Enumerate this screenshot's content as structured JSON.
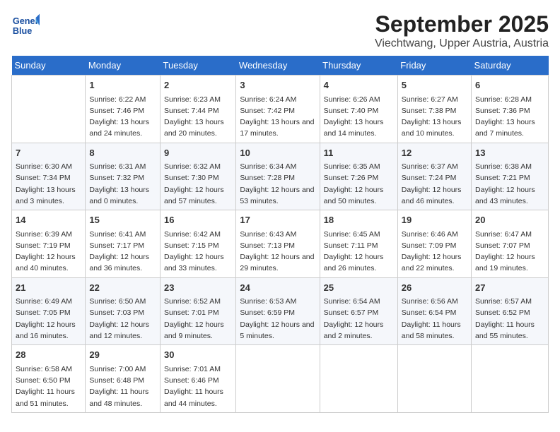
{
  "header": {
    "title": "September 2025",
    "subtitle": "Viechtwang, Upper Austria, Austria",
    "logo_line1": "General",
    "logo_line2": "Blue"
  },
  "weekdays": [
    "Sunday",
    "Monday",
    "Tuesday",
    "Wednesday",
    "Thursday",
    "Friday",
    "Saturday"
  ],
  "weeks": [
    [
      {
        "day": "",
        "sunrise": "",
        "sunset": "",
        "daylight": ""
      },
      {
        "day": "1",
        "sunrise": "Sunrise: 6:22 AM",
        "sunset": "Sunset: 7:46 PM",
        "daylight": "Daylight: 13 hours and 24 minutes."
      },
      {
        "day": "2",
        "sunrise": "Sunrise: 6:23 AM",
        "sunset": "Sunset: 7:44 PM",
        "daylight": "Daylight: 13 hours and 20 minutes."
      },
      {
        "day": "3",
        "sunrise": "Sunrise: 6:24 AM",
        "sunset": "Sunset: 7:42 PM",
        "daylight": "Daylight: 13 hours and 17 minutes."
      },
      {
        "day": "4",
        "sunrise": "Sunrise: 6:26 AM",
        "sunset": "Sunset: 7:40 PM",
        "daylight": "Daylight: 13 hours and 14 minutes."
      },
      {
        "day": "5",
        "sunrise": "Sunrise: 6:27 AM",
        "sunset": "Sunset: 7:38 PM",
        "daylight": "Daylight: 13 hours and 10 minutes."
      },
      {
        "day": "6",
        "sunrise": "Sunrise: 6:28 AM",
        "sunset": "Sunset: 7:36 PM",
        "daylight": "Daylight: 13 hours and 7 minutes."
      }
    ],
    [
      {
        "day": "7",
        "sunrise": "Sunrise: 6:30 AM",
        "sunset": "Sunset: 7:34 PM",
        "daylight": "Daylight: 13 hours and 3 minutes."
      },
      {
        "day": "8",
        "sunrise": "Sunrise: 6:31 AM",
        "sunset": "Sunset: 7:32 PM",
        "daylight": "Daylight: 13 hours and 0 minutes."
      },
      {
        "day": "9",
        "sunrise": "Sunrise: 6:32 AM",
        "sunset": "Sunset: 7:30 PM",
        "daylight": "Daylight: 12 hours and 57 minutes."
      },
      {
        "day": "10",
        "sunrise": "Sunrise: 6:34 AM",
        "sunset": "Sunset: 7:28 PM",
        "daylight": "Daylight: 12 hours and 53 minutes."
      },
      {
        "day": "11",
        "sunrise": "Sunrise: 6:35 AM",
        "sunset": "Sunset: 7:26 PM",
        "daylight": "Daylight: 12 hours and 50 minutes."
      },
      {
        "day": "12",
        "sunrise": "Sunrise: 6:37 AM",
        "sunset": "Sunset: 7:24 PM",
        "daylight": "Daylight: 12 hours and 46 minutes."
      },
      {
        "day": "13",
        "sunrise": "Sunrise: 6:38 AM",
        "sunset": "Sunset: 7:21 PM",
        "daylight": "Daylight: 12 hours and 43 minutes."
      }
    ],
    [
      {
        "day": "14",
        "sunrise": "Sunrise: 6:39 AM",
        "sunset": "Sunset: 7:19 PM",
        "daylight": "Daylight: 12 hours and 40 minutes."
      },
      {
        "day": "15",
        "sunrise": "Sunrise: 6:41 AM",
        "sunset": "Sunset: 7:17 PM",
        "daylight": "Daylight: 12 hours and 36 minutes."
      },
      {
        "day": "16",
        "sunrise": "Sunrise: 6:42 AM",
        "sunset": "Sunset: 7:15 PM",
        "daylight": "Daylight: 12 hours and 33 minutes."
      },
      {
        "day": "17",
        "sunrise": "Sunrise: 6:43 AM",
        "sunset": "Sunset: 7:13 PM",
        "daylight": "Daylight: 12 hours and 29 minutes."
      },
      {
        "day": "18",
        "sunrise": "Sunrise: 6:45 AM",
        "sunset": "Sunset: 7:11 PM",
        "daylight": "Daylight: 12 hours and 26 minutes."
      },
      {
        "day": "19",
        "sunrise": "Sunrise: 6:46 AM",
        "sunset": "Sunset: 7:09 PM",
        "daylight": "Daylight: 12 hours and 22 minutes."
      },
      {
        "day": "20",
        "sunrise": "Sunrise: 6:47 AM",
        "sunset": "Sunset: 7:07 PM",
        "daylight": "Daylight: 12 hours and 19 minutes."
      }
    ],
    [
      {
        "day": "21",
        "sunrise": "Sunrise: 6:49 AM",
        "sunset": "Sunset: 7:05 PM",
        "daylight": "Daylight: 12 hours and 16 minutes."
      },
      {
        "day": "22",
        "sunrise": "Sunrise: 6:50 AM",
        "sunset": "Sunset: 7:03 PM",
        "daylight": "Daylight: 12 hours and 12 minutes."
      },
      {
        "day": "23",
        "sunrise": "Sunrise: 6:52 AM",
        "sunset": "Sunset: 7:01 PM",
        "daylight": "Daylight: 12 hours and 9 minutes."
      },
      {
        "day": "24",
        "sunrise": "Sunrise: 6:53 AM",
        "sunset": "Sunset: 6:59 PM",
        "daylight": "Daylight: 12 hours and 5 minutes."
      },
      {
        "day": "25",
        "sunrise": "Sunrise: 6:54 AM",
        "sunset": "Sunset: 6:57 PM",
        "daylight": "Daylight: 12 hours and 2 minutes."
      },
      {
        "day": "26",
        "sunrise": "Sunrise: 6:56 AM",
        "sunset": "Sunset: 6:54 PM",
        "daylight": "Daylight: 11 hours and 58 minutes."
      },
      {
        "day": "27",
        "sunrise": "Sunrise: 6:57 AM",
        "sunset": "Sunset: 6:52 PM",
        "daylight": "Daylight: 11 hours and 55 minutes."
      }
    ],
    [
      {
        "day": "28",
        "sunrise": "Sunrise: 6:58 AM",
        "sunset": "Sunset: 6:50 PM",
        "daylight": "Daylight: 11 hours and 51 minutes."
      },
      {
        "day": "29",
        "sunrise": "Sunrise: 7:00 AM",
        "sunset": "Sunset: 6:48 PM",
        "daylight": "Daylight: 11 hours and 48 minutes."
      },
      {
        "day": "30",
        "sunrise": "Sunrise: 7:01 AM",
        "sunset": "Sunset: 6:46 PM",
        "daylight": "Daylight: 11 hours and 44 minutes."
      },
      {
        "day": "",
        "sunrise": "",
        "sunset": "",
        "daylight": ""
      },
      {
        "day": "",
        "sunrise": "",
        "sunset": "",
        "daylight": ""
      },
      {
        "day": "",
        "sunrise": "",
        "sunset": "",
        "daylight": ""
      },
      {
        "day": "",
        "sunrise": "",
        "sunset": "",
        "daylight": ""
      }
    ]
  ]
}
